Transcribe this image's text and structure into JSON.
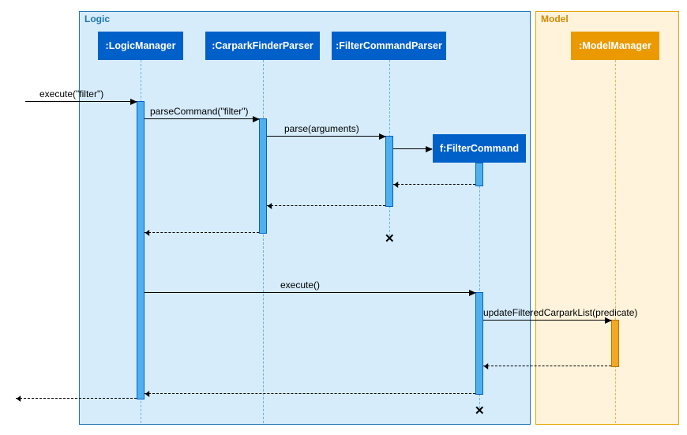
{
  "regions": {
    "logic_label": "Logic",
    "model_label": "Model"
  },
  "objects": {
    "logic_manager": ":LogicManager",
    "carpark_finder_parser": ":CarparkFinderParser",
    "filter_command_parser": ":FilterCommandParser",
    "filter_command": "f:FilterCommand",
    "model_manager": ":ModelManager"
  },
  "messages": {
    "m1": "execute(\"filter\")",
    "m2": "parseCommand(\"filter\")",
    "m3": "parse(arguments)",
    "m4": "execute()",
    "m5": "updateFilteredCarparkList(predicate)"
  },
  "chart_data": {
    "type": "sequence_diagram",
    "frames": [
      {
        "name": "Logic",
        "lifelines": [
          ":LogicManager",
          ":CarparkFinderParser",
          ":FilterCommandParser",
          "f:FilterCommand"
        ]
      },
      {
        "name": "Model",
        "lifelines": [
          ":ModelManager"
        ]
      }
    ],
    "lifelines": [
      {
        "id": "LM",
        "label": ":LogicManager",
        "created_at_start": true,
        "destroyed": false
      },
      {
        "id": "CFP",
        "label": ":CarparkFinderParser",
        "created_at_start": true,
        "destroyed": false
      },
      {
        "id": "FCP",
        "label": ":FilterCommandParser",
        "created_at_start": true,
        "destroyed": true
      },
      {
        "id": "FC",
        "label": "f:FilterCommand",
        "created_at_start": false,
        "destroyed": true
      },
      {
        "id": "MM",
        "label": ":ModelManager",
        "created_at_start": true,
        "destroyed": false
      }
    ],
    "messages": [
      {
        "from": "caller",
        "to": "LM",
        "label": "execute(\"filter\")",
        "type": "sync"
      },
      {
        "from": "LM",
        "to": "CFP",
        "label": "parseCommand(\"filter\")",
        "type": "sync"
      },
      {
        "from": "CFP",
        "to": "FCP",
        "label": "parse(arguments)",
        "type": "sync"
      },
      {
        "from": "FCP",
        "to": "FC",
        "label": "",
        "type": "create"
      },
      {
        "from": "FC",
        "to": "FCP",
        "label": "",
        "type": "return"
      },
      {
        "from": "FCP",
        "to": "CFP",
        "label": "",
        "type": "return"
      },
      {
        "from": "CFP",
        "to": "LM",
        "label": "",
        "type": "return"
      },
      {
        "from": "LM",
        "to": "FC",
        "label": "execute()",
        "type": "sync"
      },
      {
        "from": "FC",
        "to": "MM",
        "label": "updateFilteredCarparkList(predicate)",
        "type": "sync"
      },
      {
        "from": "MM",
        "to": "FC",
        "label": "",
        "type": "return"
      },
      {
        "from": "FC",
        "to": "LM",
        "label": "",
        "type": "return"
      },
      {
        "from": "LM",
        "to": "caller",
        "label": "",
        "type": "return"
      }
    ]
  }
}
